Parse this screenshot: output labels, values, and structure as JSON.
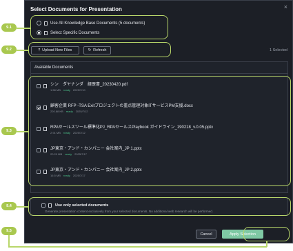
{
  "dialog": {
    "title": "Select Documents for Presentation",
    "close_glyph": "×"
  },
  "scope": {
    "options": [
      {
        "label": "Use All Knowledge Base Documents (5 documents)",
        "selected": false,
        "icon": "database-icon"
      },
      {
        "label": "Select Specific Documents",
        "selected": true,
        "icon": "document-icon"
      }
    ]
  },
  "toolbar": {
    "upload_label": "Upload New Files",
    "upload_icon": "⤒",
    "refresh_label": "Refresh",
    "refresh_icon": "↻",
    "selected_count": "1 Selected"
  },
  "documents": {
    "header": "Available Documents",
    "files": [
      {
        "name": "シン　ダヤナンダ　経歴書_20230420.pdf",
        "size": "1.58 MB",
        "status": "ready",
        "date": "2025/7/10",
        "checked": false
      },
      {
        "name": "顧客企業 RFP -TSA Exitプロジェクトの重点管理対象ITサービスPM支援.docx",
        "size": "220.88 KB",
        "status": "ready",
        "date": "2025/7/12",
        "checked": true
      },
      {
        "name": "RPAセールスツール標準化PJ_RPAセールスPlaybook ガイドライン_190218_v.0.05.pptx",
        "size": "2.91 MB",
        "status": "ready",
        "date": "2025/7/12",
        "checked": false
      },
      {
        "name": "JP東京・アンド・カンパニー 会社案内_JP 1.pptx",
        "size": "20.20 MB",
        "status": "ready",
        "date": "2025/7/17",
        "checked": false
      },
      {
        "name": "JP東京・アンド・カンパニー 会社案内_JP 2.pptx",
        "size": "16.5 MB",
        "status": "ready",
        "date": "2025/7/17",
        "checked": false
      }
    ]
  },
  "selected_only": {
    "title": "Use only selected documents",
    "description": "Generate presentation content exclusively from your selected documents. No additional web research will be performed.",
    "checked": false,
    "icon": "lock-icon"
  },
  "footer": {
    "cancel_label": "Cancel",
    "apply_label": "Apply Selection"
  },
  "callouts": [
    "9.1",
    "9.2",
    "9.3",
    "9.4",
    "9.5"
  ],
  "colors": {
    "callout": "#a9c84f",
    "highlight": "#b8d66a",
    "apply": "#7fc9a4",
    "ready": "#4cc38a",
    "dialog_bg": "#1c1f26"
  }
}
